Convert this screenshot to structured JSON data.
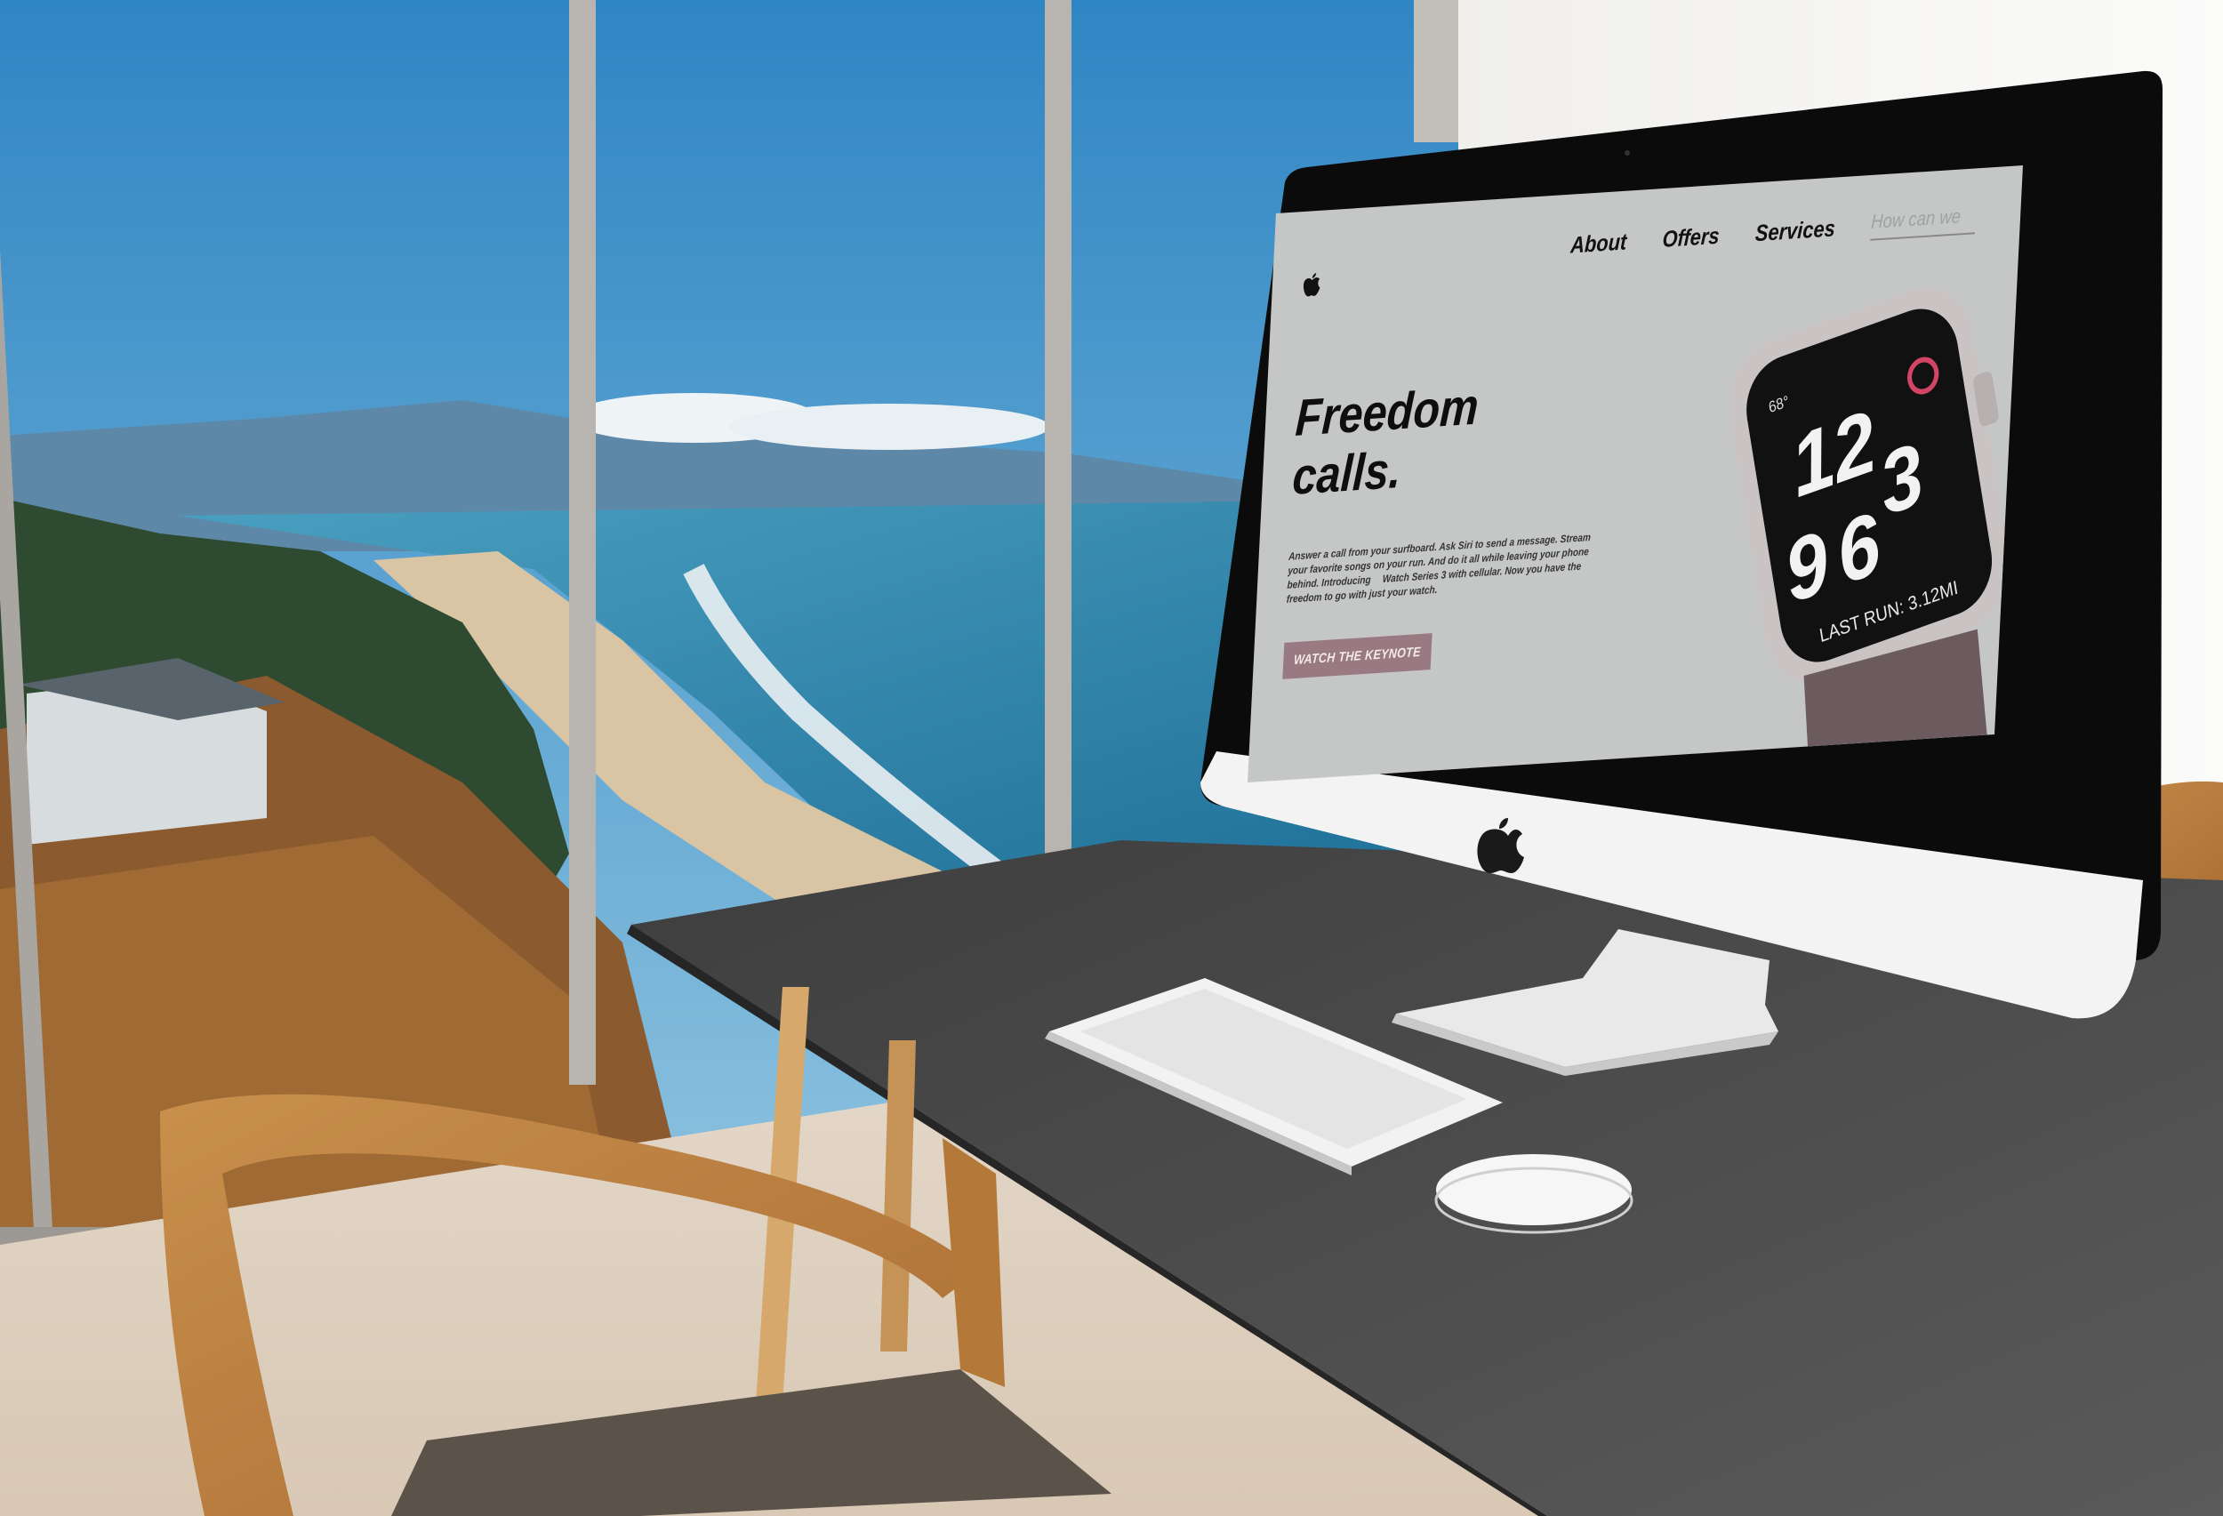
{
  "nav": {
    "about": "About",
    "offers": "Offers",
    "services": "Services",
    "search_placeholder": "How can we"
  },
  "hero": {
    "title_line1": "Freedom",
    "title_line2": "calls.",
    "body": "Answer a call from your surfboard. Ask Siri to send a message. Stream your favorite songs on your run. And do it all while leaving your phone behind. Introducing  Watch Series 3 with cellular. Now you have the freedom to go with just your watch.",
    "cta": "WATCH THE KEYNOTE"
  },
  "watch_face": {
    "hour_top": "12",
    "numeral_nine": "9",
    "numeral_six": "6",
    "numeral_three": "3",
    "top_left": "68°",
    "bottom_text": "LAST RUN: 3.12MI"
  },
  "colors": {
    "screen_bg": "#c5c7c6",
    "cta_bg": "#9a7a82",
    "desk": "#4b4b4b",
    "sky": "#3f8fc6",
    "sea": "#3c8fb0"
  },
  "icons": [
    "apple-logo-icon"
  ]
}
